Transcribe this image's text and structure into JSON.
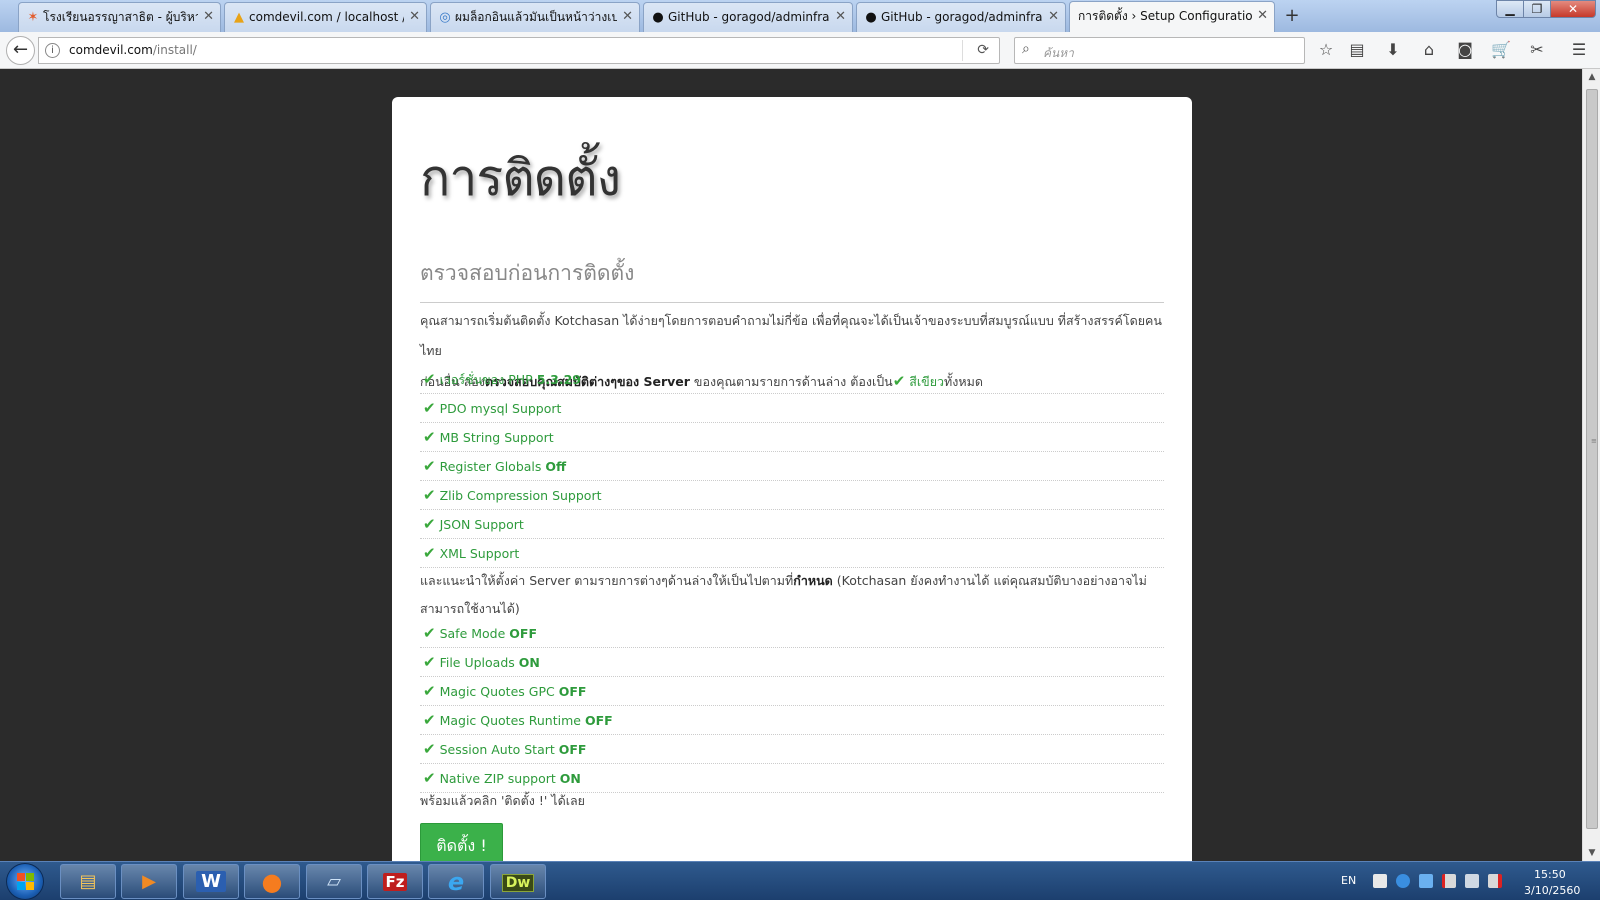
{
  "browser": {
    "tabs": [
      {
        "label": "โรงเรียนอรรญาสาธิต - ผู้บริหาร",
        "favicon": "joomla-icon",
        "color": "#e25c2c",
        "glyph": "✶"
      },
      {
        "label": "comdevil.com / localhost / c",
        "favicon": "phpmyadmin-icon",
        "color": "#e8a317",
        "glyph": "▲"
      },
      {
        "label": "ผมล็อกอินแล้วมันเป็นหน้าว่างเปล่",
        "favicon": "forum-icon",
        "color": "#3b7bc8",
        "glyph": "◎"
      },
      {
        "label": "GitHub - goragod/adminfran",
        "favicon": "github-icon",
        "color": "#111111",
        "glyph": "●"
      },
      {
        "label": "GitHub - goragod/adminfran",
        "favicon": "github-icon",
        "color": "#111111",
        "glyph": "●"
      },
      {
        "label": "การติดตั้ง › Setup Configuration Fi",
        "favicon": "",
        "color": "#333333",
        "glyph": ""
      }
    ],
    "new_tab": "+",
    "url_host": "comdevil.com",
    "url_path": "/install/",
    "search_placeholder": "ค้นหา"
  },
  "page": {
    "title": "การติดตั้ง",
    "subtitle": "ตรวจสอบก่อนการติดตั้ง",
    "intro_line1": "คุณสามารถเริ่มต้นติดตั้ง Kotchasan ได้ง่ายๆโดยการตอบคำถามไม่กี่ข้อ เพื่อที่คุณจะได้เป็นเจ้าของระบบที่สมบูรณ์แบบ ที่สร้างสรรค์โดยคนไทย",
    "intro_line2_a": "ก่อนอื่น ลอง",
    "intro_line2_bold": "ตรวจสอบคุณสมบัติต่างๆของ Server",
    "intro_line2_b": " ของคุณตามรายการด้านล่าง ต้องเป็น",
    "intro_green": " สีเขียว",
    "intro_end": "ทั้งหมด",
    "requirements": [
      {
        "label": "เวอร์ชั่นของ PHP ",
        "value": "5.3.29"
      },
      {
        "label": "PDO mysql Support",
        "value": ""
      },
      {
        "label": "MB String Support",
        "value": ""
      },
      {
        "label": "Register Globals ",
        "value": "Off"
      },
      {
        "label": "Zlib Compression Support",
        "value": ""
      },
      {
        "label": "JSON Support",
        "value": ""
      },
      {
        "label": "XML Support",
        "value": ""
      }
    ],
    "rec_a": "และแนะนำให้ตั้งค่า Server ตามรายการต่างๆด้านล่างให้เป็นไปตามที่",
    "rec_bold": "กำหนด",
    "rec_b": " (Kotchasan ยังคงทำงานได้ แต่คุณสมบัติบางอย่างอาจไม่สามารถใช้งานได้)",
    "settings": [
      {
        "label": "Safe Mode ",
        "value": "OFF"
      },
      {
        "label": "File Uploads ",
        "value": "ON"
      },
      {
        "label": "Magic Quotes GPC ",
        "value": "OFF"
      },
      {
        "label": "Magic Quotes Runtime ",
        "value": "OFF"
      },
      {
        "label": "Session Auto Start ",
        "value": "OFF"
      },
      {
        "label": "Native ZIP support ",
        "value": "ON"
      }
    ],
    "ready_text": "พร้อมแล้วคลิก 'ติดตั้ง !' ได้เลย",
    "install_button": "ติดตั้ง !"
  },
  "taskbar": {
    "apps": [
      {
        "name": "explorer-icon",
        "glyph": "▤",
        "color": "#f2c45a"
      },
      {
        "name": "media-player-icon",
        "glyph": "▶",
        "color": "#f08a24"
      },
      {
        "name": "word-icon",
        "glyph": "W",
        "color": "#ffffff",
        "bg": "#2b5fb0"
      },
      {
        "name": "firefox-icon",
        "glyph": "●",
        "color": "#f57c1f"
      },
      {
        "name": "notepad-icon",
        "glyph": "▱",
        "color": "#cfe3f7"
      },
      {
        "name": "filezilla-icon",
        "glyph": "Fz",
        "color": "#ffffff",
        "bg": "#bf1e1e"
      },
      {
        "name": "ie-icon",
        "glyph": "e",
        "color": "#3ba7f0"
      },
      {
        "name": "dreamweaver-icon",
        "glyph": "Dw",
        "color": "#d8f25c",
        "bg": "#3a4a16"
      }
    ],
    "lang": "EN",
    "time": "15:50",
    "date": "3/10/2560"
  }
}
